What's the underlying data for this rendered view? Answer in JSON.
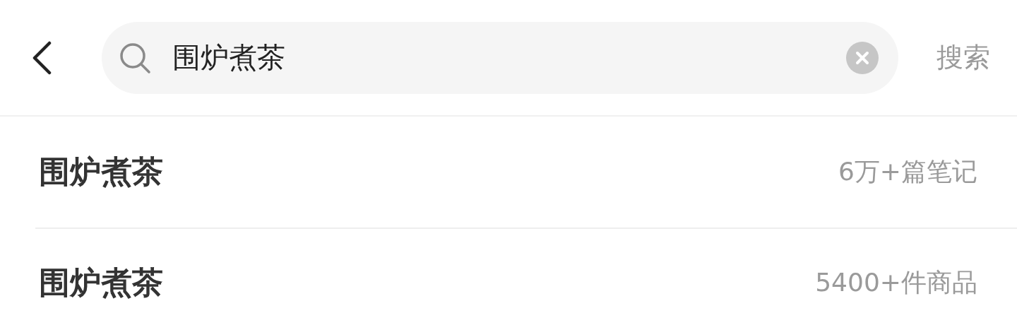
{
  "search": {
    "value": "围炉煮茶"
  },
  "search_button": "搜索",
  "suggestions": [
    {
      "title": "围炉煮茶",
      "count": "6万+篇笔记"
    },
    {
      "title": "围炉煮茶",
      "count": "5400+件商品"
    }
  ]
}
